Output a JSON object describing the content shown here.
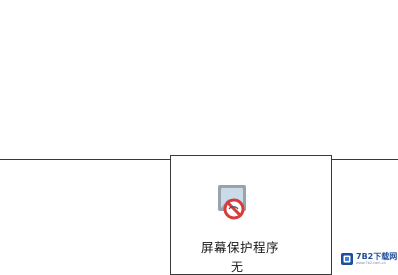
{
  "screensaver": {
    "label": "屏幕保护程序",
    "value": "无",
    "icon": "screensaver-disabled-icon"
  },
  "watermark": {
    "text": "7B2下载网",
    "subtext": "www.7b2.com.cn",
    "icon": "site-logo-icon",
    "accent_color": "#1d4e9e"
  },
  "colors": {
    "prohibit_red": "#d93a3a",
    "frame_gray": "#9aa3ac",
    "screen_blue": "#c9dbe9"
  }
}
